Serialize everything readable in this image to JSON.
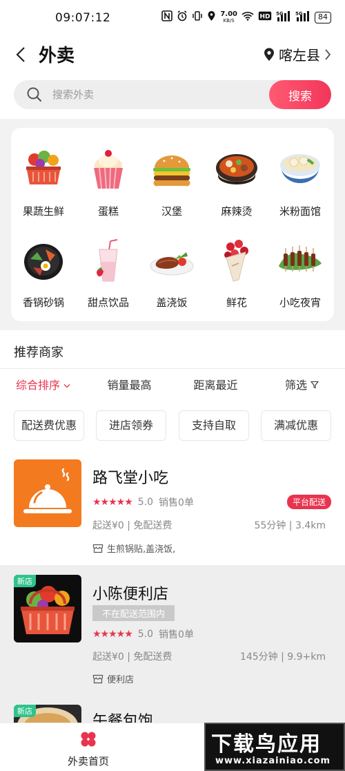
{
  "status_bar": {
    "time": "09:07:12",
    "speed": "7.00",
    "speed_unit": "KB/S",
    "battery": "84"
  },
  "header": {
    "title": "外卖",
    "location": "喀左县"
  },
  "search": {
    "placeholder": "搜索外卖",
    "button": "搜索"
  },
  "categories": [
    {
      "label": "果蔬生鲜",
      "icon": "fruit-basket-icon"
    },
    {
      "label": "蛋糕",
      "icon": "cupcake-icon"
    },
    {
      "label": "汉堡",
      "icon": "burger-icon"
    },
    {
      "label": "麻辣烫",
      "icon": "hotpot-bowl-icon"
    },
    {
      "label": "米粉面馆",
      "icon": "noodle-bowl-icon"
    },
    {
      "label": "香锅砂锅",
      "icon": "claypot-icon"
    },
    {
      "label": "甜点饮品",
      "icon": "drink-icon"
    },
    {
      "label": "盖浇饭",
      "icon": "steak-plate-icon"
    },
    {
      "label": "鲜花",
      "icon": "flower-bouquet-icon"
    },
    {
      "label": "小吃夜宵",
      "icon": "skewer-icon"
    }
  ],
  "section_title": "推荐商家",
  "sort_options": [
    "综合排序",
    "销量最高",
    "距离最近",
    "筛选"
  ],
  "filter_chips": [
    "配送费优惠",
    "进店领券",
    "支持自取",
    "满减优惠"
  ],
  "stores": [
    {
      "name": "路飞堂小吃",
      "score": "5.0",
      "sales": "销售0单",
      "badge": "平台配送",
      "fee": "起送¥0 | 免配送费",
      "time_distance": "55分钟 | 3.4km",
      "tags": "生煎锅贴,盖浇饭,"
    },
    {
      "name": "小陈便利店",
      "new_label": "新店",
      "range_status": "不在配送范围内",
      "score": "5.0",
      "sales": "销售0单",
      "fee": "起送¥0 | 免配送费",
      "time_distance": "145分钟 | 9.9+km",
      "tags": "便利店"
    },
    {
      "name": "午餐包饱",
      "new_label": "新店"
    }
  ],
  "bottom_nav": {
    "home": "外卖首页"
  },
  "watermark": {
    "main": "下载鸟应用",
    "sub": "www.xiazainiao.com"
  },
  "colors": {
    "accent": "#e8344f",
    "store1_thumb": "#f47a20",
    "new_tag": "#30c38b"
  }
}
